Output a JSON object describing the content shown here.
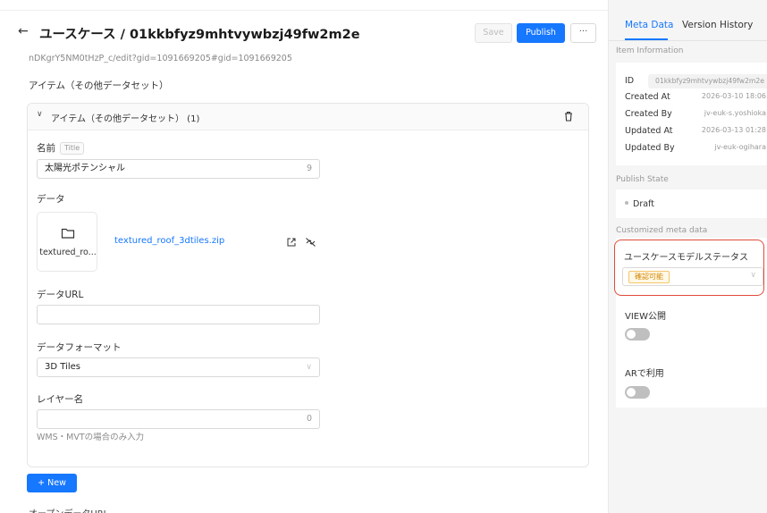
{
  "header": {
    "back_icon": "arrow-left-icon",
    "title": "ユースケース / 01kkbfyz9mhtvywbzj49fw2m2e",
    "save_label": "Save",
    "publish_label": "Publish",
    "more_label": "···"
  },
  "main": {
    "url_fragment": "nDKgrY5NM0tHzP_c/edit?gid=1091669205#gid=1091669205",
    "section_label": "アイテム（その他データセット）",
    "card": {
      "title": "アイテム（その他データセット） (1)",
      "name_label": "名前",
      "name_tag": "Title",
      "name_value": "太陽光ポテンシャル",
      "name_count": "9",
      "data_label": "データ",
      "file_tile_name": "textured_ro...",
      "file_link": "textured_roof_3dtiles.zip",
      "data_url_label": "データURL",
      "data_url_value": "",
      "format_label": "データフォーマット",
      "format_value": "3D Tiles",
      "layer_label": "レイヤー名",
      "layer_value": "",
      "layer_count": "0",
      "layer_help": "WMS・MVTの場合のみ入力"
    },
    "new_button_label": "+ New",
    "cut_label": "オープンデータURL"
  },
  "sidebar": {
    "tabs": [
      {
        "label": "Meta Data",
        "active": true
      },
      {
        "label": "Version History",
        "active": false
      }
    ],
    "item_info_heading": "Item Information",
    "item_info": [
      {
        "label": "ID",
        "value": "01kkbfyz9mhtvywbzj49fw2m2e"
      },
      {
        "label": "Created At",
        "value": "2026-03-10 18:06"
      },
      {
        "label": "Created By",
        "value": "jv-euk-s.yoshioka"
      },
      {
        "label": "Updated At",
        "value": "2026-03-13 01:28"
      },
      {
        "label": "Updated By",
        "value": "jv-euk-ogihara"
      }
    ],
    "publish_state_heading": "Publish State",
    "publish_state": "Draft",
    "custom_meta_heading": "Customized meta data",
    "custom_meta": {
      "status_label": "ユースケースモデルステータス",
      "status_value": "確認可能",
      "view_label": "VIEW公開",
      "view_on": false,
      "ar_label": "ARで利用",
      "ar_on": false
    }
  },
  "colors": {
    "primary": "#1677ff",
    "highlight_border": "#e04a3a",
    "status_tag": "#d48806"
  }
}
